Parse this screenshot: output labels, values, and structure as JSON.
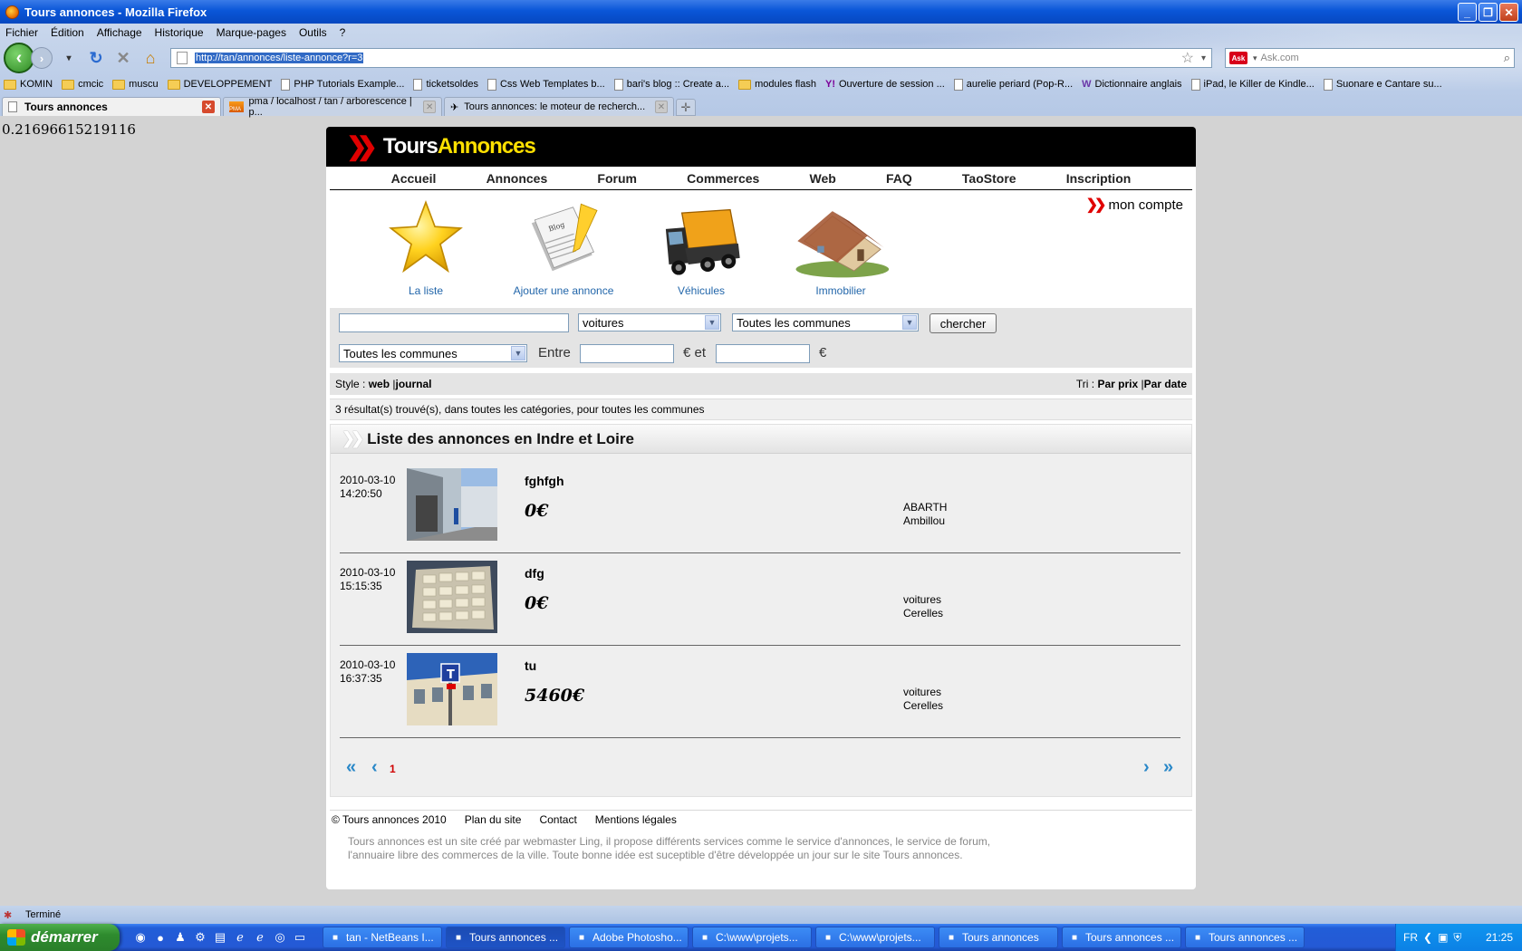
{
  "window": {
    "title": "Tours annonces - Mozilla Firefox"
  },
  "menu": {
    "items": [
      "Fichier",
      "Édition",
      "Affichage",
      "Historique",
      "Marque-pages",
      "Outils",
      "?"
    ]
  },
  "address": {
    "url": "http://tan/annonces/liste-annonce?r=3",
    "search_placeholder": "Ask.com",
    "search_logo": "Ask"
  },
  "bookmarks": [
    {
      "label": "KOMIN",
      "icon": "folder"
    },
    {
      "label": "cmcic",
      "icon": "folder"
    },
    {
      "label": "muscu",
      "icon": "folder"
    },
    {
      "label": "DEVELOPPEMENT",
      "icon": "folder"
    },
    {
      "label": "PHP Tutorials Example...",
      "icon": "doc"
    },
    {
      "label": "ticketsoldes",
      "icon": "doc"
    },
    {
      "label": "Css Web Templates b...",
      "icon": "doc"
    },
    {
      "label": "bari's blog :: Create a...",
      "icon": "doc"
    },
    {
      "label": "modules flash",
      "icon": "folder"
    },
    {
      "label": "Ouverture de session ...",
      "icon": "yahoo"
    },
    {
      "label": "aurelie periard (Pop-R...",
      "icon": "doc"
    },
    {
      "label": "Dictionnaire anglais",
      "icon": "wr"
    },
    {
      "label": "iPad, le Killer de Kindle...",
      "icon": "doc"
    },
    {
      "label": "Suonare e Cantare su...",
      "icon": "doc"
    }
  ],
  "tabs": [
    {
      "label": "Tours annonces",
      "active": true
    },
    {
      "label": "pma / localhost / tan / arborescence | p...",
      "active": false
    },
    {
      "label": "Tours annonces: le moteur de recherch...",
      "active": false
    }
  ],
  "page": {
    "random_number": "0.21696615219116",
    "logo": {
      "tours": "Tours",
      "annonces": "Annonces"
    },
    "nav": [
      "Accueil",
      "Annonces",
      "Forum",
      "Commerces",
      "Web",
      "FAQ",
      "TaoStore",
      "Inscription"
    ],
    "mon_compte": "mon compte",
    "categories": [
      {
        "label": "La liste",
        "icon": "star-icon"
      },
      {
        "label": "Ajouter une annonce",
        "icon": "blog-icon"
      },
      {
        "label": "Véhicules",
        "icon": "truck-icon"
      },
      {
        "label": "Immobilier",
        "icon": "house-icon"
      }
    ],
    "search": {
      "keyword_value": "",
      "category_selected": "voitures",
      "commune_selected": "Toutes les communes",
      "button": "chercher",
      "commune2_selected": "Toutes les communes",
      "entre_label": "Entre",
      "price_min": "",
      "et_label": "€ et",
      "price_max": "",
      "euro_label": "€"
    },
    "style_bar": {
      "style_label": "Style :",
      "web": "web",
      "sep": "|",
      "journal": "journal",
      "tri_label": "Tri :",
      "par_prix": "Par prix",
      "par_date": "Par date"
    },
    "results_text": "3 résultat(s) trouvé(s), dans toutes les catégories, pour toutes les communes",
    "list_title": "Liste des annonces en Indre et Loire",
    "ads": [
      {
        "date": "2010-03-10",
        "time": "14:20:50",
        "title": "fghfgh",
        "price": "0€",
        "category": "ABARTH",
        "commune": "Ambillou"
      },
      {
        "date": "2010-03-10",
        "time": "15:15:35",
        "title": "dfg",
        "price": "0€",
        "category": "voitures",
        "commune": "Cerelles"
      },
      {
        "date": "2010-03-10",
        "time": "16:37:35",
        "title": "tu",
        "price": "5460€",
        "category": "voitures",
        "commune": "Cerelles"
      }
    ],
    "pager": {
      "first": "«",
      "prev": "‹",
      "current": "1",
      "next": "›",
      "last": "»"
    },
    "footer": {
      "links": [
        "© Tours annonces 2010",
        "Plan du site",
        "Contact",
        "Mentions légales"
      ],
      "text": "Tours annonces est un site créé par webmaster Ling, il propose différents services comme le service d'annonces, le service de forum, l'annuaire libre des commerces de la ville. Toute bonne idée est suceptible d'être développée un jour sur le site Tours annonces."
    }
  },
  "status": {
    "text": "Terminé"
  },
  "taskbar": {
    "start": "démarrer",
    "tasks": [
      {
        "label": "tan - NetBeans I...",
        "active": false
      },
      {
        "label": "Tours annonces ...",
        "active": true
      },
      {
        "label": "Adobe Photosho...",
        "active": false
      },
      {
        "label": "C:\\www\\projets...",
        "active": false
      },
      {
        "label": "C:\\www\\projets...",
        "active": false
      },
      {
        "label": "Tours annonces",
        "active": false
      },
      {
        "label": "Tours annonces ...",
        "active": false
      },
      {
        "label": "Tours annonces ...",
        "active": false
      }
    ],
    "lang": "FR",
    "clock": "21:25"
  },
  "colors": {
    "accent_red": "#e00000",
    "logo_yellow": "#ffe000",
    "link_blue": "#2266aa",
    "xp_blue": "#225ed8"
  }
}
